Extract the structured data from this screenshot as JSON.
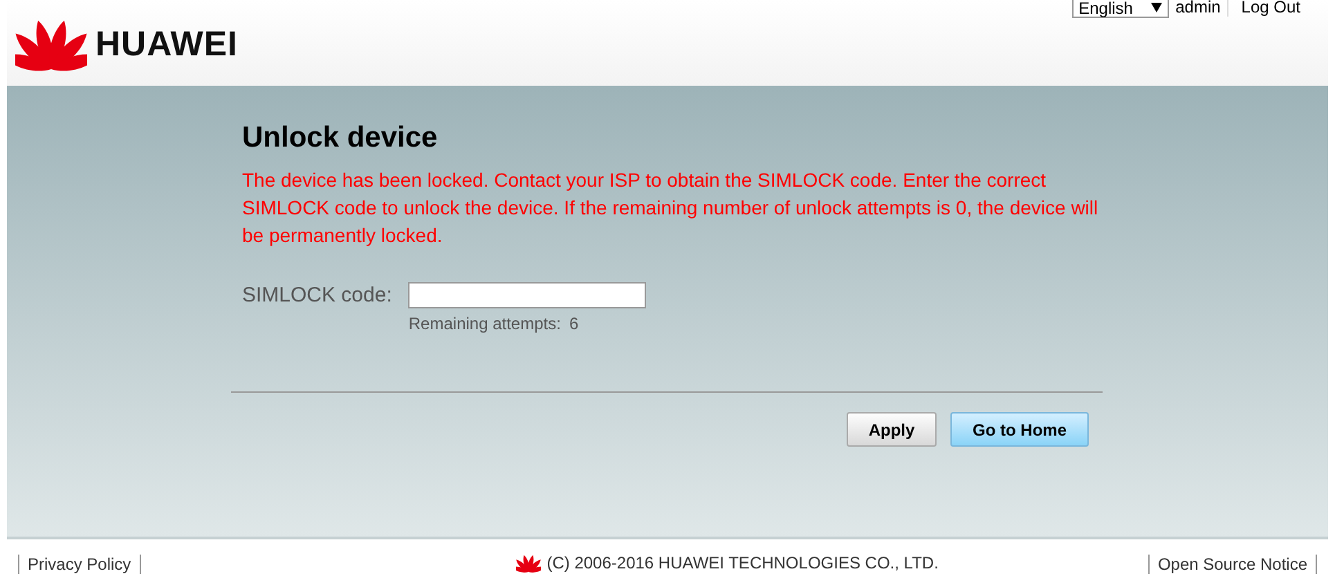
{
  "header": {
    "brand": "HUAWEI",
    "language": "English",
    "user": "admin",
    "logout": "Log Out"
  },
  "unlock": {
    "title": "Unlock device",
    "message": "The device has been locked. Contact your ISP to obtain the SIMLOCK code. Enter the correct SIMLOCK code to unlock the device. If the remaining number of unlock attempts is 0, the device will be permanently locked.",
    "field_label": "SIMLOCK code:",
    "remaining_label": "Remaining attempts:",
    "remaining_count": "6"
  },
  "buttons": [
    {
      "label": "Apply",
      "kind": "secondary"
    },
    {
      "label": "Go to Home",
      "kind": "primary"
    }
  ],
  "footer": {
    "privacy": "Privacy Policy",
    "copyright": "(C) 2006-2016 HUAWEI TECHNOLOGIES CO., LTD.",
    "open_source": "Open Source Notice"
  }
}
